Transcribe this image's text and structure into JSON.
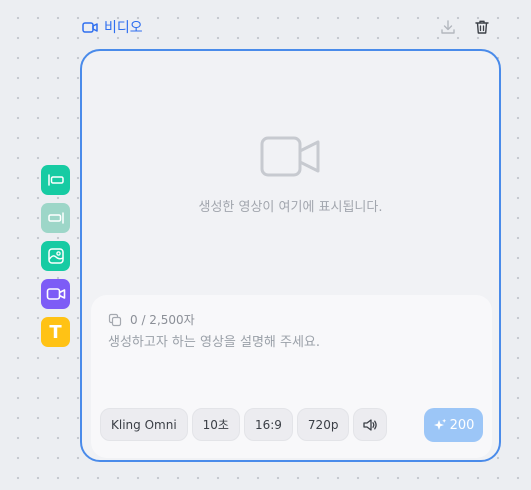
{
  "header": {
    "title": "비디오",
    "icons": [
      "video-icon",
      "download-icon",
      "trash-icon"
    ],
    "accent_color": "#2f6ff0"
  },
  "preview": {
    "placeholder_text": "생성한 영상이 여기에 표시됩니다.",
    "icon": "video-camera-icon"
  },
  "prompt": {
    "counter": "0 / 2,500자",
    "placeholder": "생성하고자 하는 영상을 설명해 주세요."
  },
  "options": {
    "model": "Kling Omni",
    "duration": "10초",
    "aspect_ratio": "16:9",
    "resolution": "720p",
    "sound_icon": "speaker-icon"
  },
  "generate": {
    "cost": "200",
    "icon": "sparkle-icon",
    "color": "#9cc6f7"
  },
  "toolbar": {
    "tools": [
      "align-left-tool",
      "align-right-tool",
      "image-tool",
      "video-tool",
      "text-tool"
    ],
    "text_tool_glyph": "T"
  }
}
